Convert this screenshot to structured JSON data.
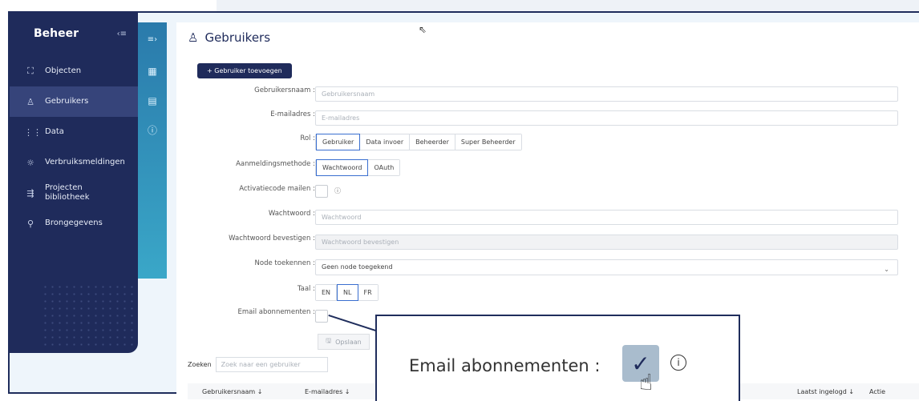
{
  "sidebar": {
    "title": "Beheer",
    "collapse_icon": "‹≡",
    "items": [
      {
        "label": "Objecten",
        "icon": "⛶"
      },
      {
        "label": "Gebruikers",
        "icon": "♙",
        "active": true
      },
      {
        "label": "Data",
        "icon": "⋮⋮"
      },
      {
        "label": "Verbruiksmeldingen",
        "icon": "☼"
      },
      {
        "label": "Projecten",
        "label2": "bibliotheek",
        "icon": "⇶"
      },
      {
        "label": "Brongegevens",
        "icon": "⚲"
      }
    ]
  },
  "rail": {
    "top_icon": "≡›",
    "icons": [
      "▦",
      "▤",
      "ⓘ"
    ]
  },
  "header": {
    "title": "Gebruikers",
    "title_icon": "♙"
  },
  "add_button": {
    "label": "+ Gebruiker toevoegen"
  },
  "form": {
    "username": {
      "label": "Gebruikersnaam",
      "placeholder": "Gebruikersnaam"
    },
    "email": {
      "label": "E-mailadres",
      "placeholder": "E-mailadres"
    },
    "role": {
      "label": "Rol",
      "options": [
        "Gebruiker",
        "Data invoer",
        "Beheerder",
        "Super Beheerder"
      ],
      "selected": "Gebruiker"
    },
    "login_method": {
      "label": "Aanmeldingsmethode",
      "options": [
        "Wachtwoord",
        "OAuth"
      ],
      "selected": "Wachtwoord"
    },
    "activation_mail": {
      "label": "Activatiecode mailen",
      "info_icon": "ⓘ"
    },
    "password": {
      "label": "Wachtwoord",
      "placeholder": "Wachtwoord"
    },
    "password_confirm": {
      "label": "Wachtwoord bevestigen",
      "placeholder": "Wachtwoord bevestigen"
    },
    "node": {
      "label": "Node toekennen",
      "value": "Geen node toegekend",
      "chevron": "⌄"
    },
    "language": {
      "label": "Taal",
      "options": [
        "EN",
        "NL",
        "FR"
      ],
      "selected": "NL"
    },
    "email_subscriptions": {
      "label": "Email abonnementen"
    }
  },
  "save_button": {
    "label": "Opslaan",
    "icon": "🖫"
  },
  "search": {
    "label": "Zoeken",
    "placeholder": "Zoek naar een gebruiker"
  },
  "table": {
    "columns": [
      "Gebruikersnaam ↓",
      "E-mailadres ↓",
      "Laatst ingelogd ↓",
      "Actie"
    ]
  },
  "zoom": {
    "label": "Email abonnementen :",
    "check": "✓",
    "info": "i",
    "hand": "☝"
  }
}
